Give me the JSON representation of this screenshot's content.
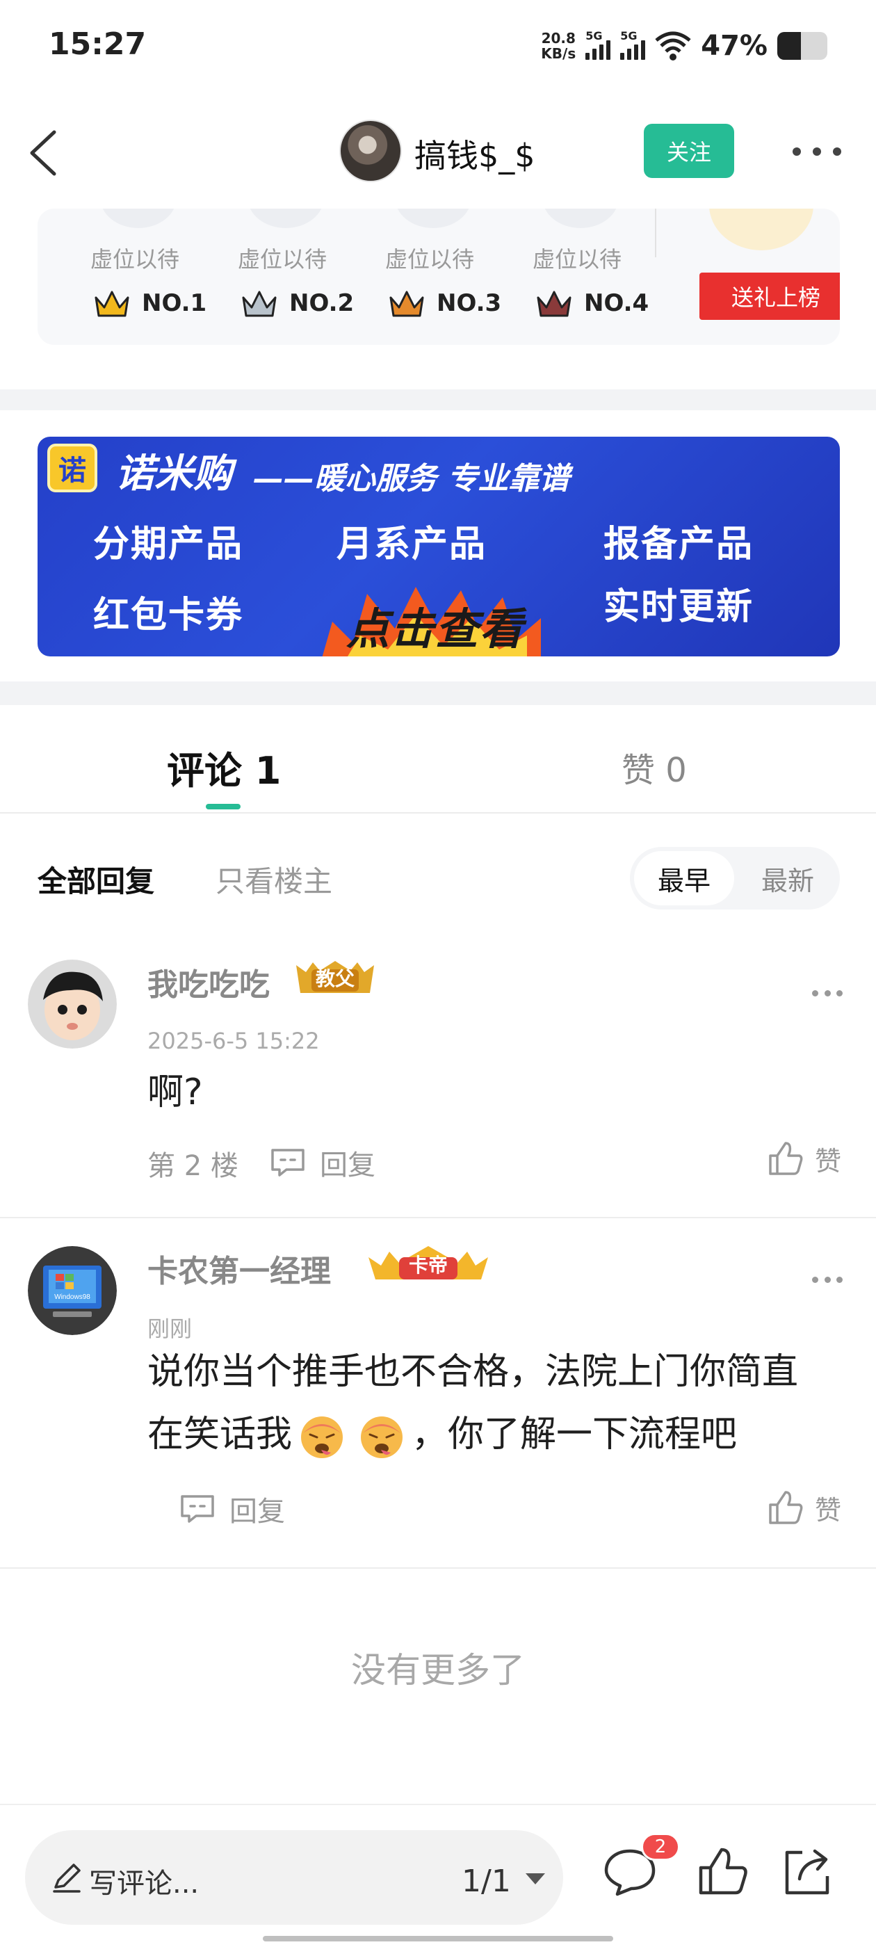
{
  "status_bar": {
    "time": "15:27",
    "net_speed_value": "20.8",
    "net_speed_unit": "KB/s",
    "sim1_label": "5G",
    "sim2_label": "5G",
    "battery": "47%",
    "battery_level": 0.47
  },
  "nav": {
    "title": "搞钱$_$",
    "follow_label": "关注"
  },
  "rank": {
    "slots": [
      {
        "placeholder": "虚位以待",
        "rank": "NO.1",
        "color": "#f2b81c"
      },
      {
        "placeholder": "虚位以待",
        "rank": "NO.2",
        "color": "#9aa6b2"
      },
      {
        "placeholder": "虚位以待",
        "rank": "NO.3",
        "color": "#e58a2c"
      },
      {
        "placeholder": "虚位以待",
        "rank": "NO.4",
        "color": "#8a3a3a"
      }
    ],
    "gift_button": "送礼上榜"
  },
  "banner": {
    "logo_char": "诺",
    "brand": "诺米购",
    "slogan": "——暖心服务 专业靠谱",
    "features": [
      "分期产品",
      "月系产品",
      "报备产品",
      "红包卡券",
      "实时更新"
    ],
    "cta": "点击查看"
  },
  "tabs": {
    "comments": "评论 1",
    "likes": "赞 0",
    "accent": "#26bc95"
  },
  "filter": {
    "all": "全部回复",
    "owner_only": "只看楼主",
    "sort_earliest": "最早",
    "sort_latest": "最新"
  },
  "comments": [
    {
      "name": "我吃吃吃",
      "badge": "教父",
      "time": "2025-6-5 15:22",
      "text": "啊?",
      "floor": "第 2 楼",
      "reply_label": "回复",
      "like_label": "赞"
    },
    {
      "name": "卡农第一经理",
      "badge": "卡帝",
      "avatar_text": "Windows98",
      "time": "刚刚",
      "text_line1": "说你当个推手也不合格，法院上门你简直",
      "text_line2a": "在笑话我",
      "text_line2b": "，你了解一下流程吧",
      "reply_label": "回复",
      "like_label": "赞"
    }
  ],
  "footer": {
    "no_more": "没有更多了"
  },
  "bottom_bar": {
    "compose_placeholder": "写评论...",
    "page_indicator": "1/1",
    "comment_badge": "2"
  }
}
